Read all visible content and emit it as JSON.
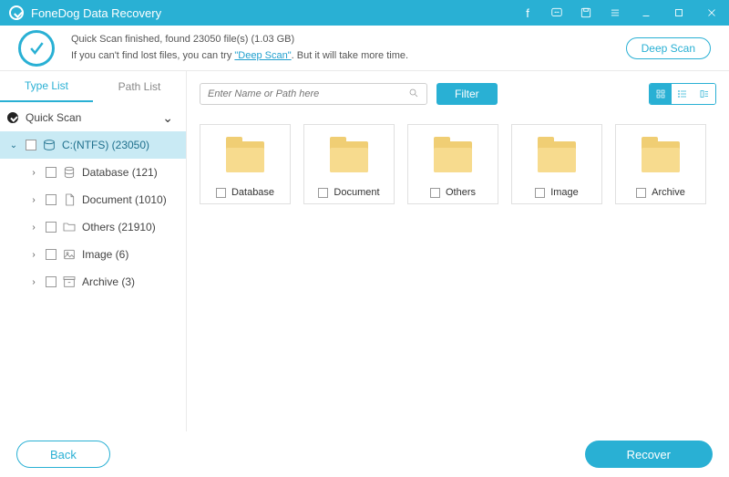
{
  "titlebar": {
    "title": "FoneDog Data Recovery"
  },
  "status": {
    "line1": "Quick Scan finished, found 23050 file(s) (1.03 GB)",
    "line2_before": "If you can't find lost files, you can try ",
    "deep_scan_link": "\"Deep Scan\"",
    "line2_after": ". But it will take more time.",
    "deep_scan_button": "Deep Scan"
  },
  "sidebar": {
    "tabs": {
      "type_list": "Type List",
      "path_list": "Path List"
    },
    "root": "Quick Scan",
    "drive": "C:(NTFS) (23050)",
    "items": [
      {
        "label": "Database (121)"
      },
      {
        "label": "Document (1010)"
      },
      {
        "label": "Others (21910)"
      },
      {
        "label": "Image (6)"
      },
      {
        "label": "Archive (3)"
      }
    ]
  },
  "toolbar": {
    "search_placeholder": "Enter Name or Path here",
    "filter": "Filter"
  },
  "folders": [
    {
      "label": "Database"
    },
    {
      "label": "Document"
    },
    {
      "label": "Others"
    },
    {
      "label": "Image"
    },
    {
      "label": "Archive"
    }
  ],
  "footer": {
    "back": "Back",
    "recover": "Recover"
  }
}
